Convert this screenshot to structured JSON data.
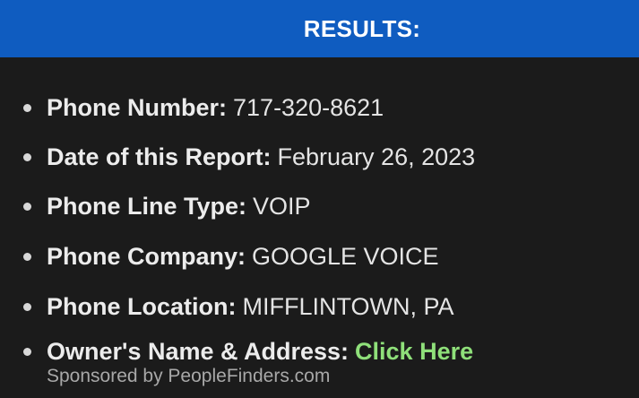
{
  "header": {
    "title": "RESULTS:"
  },
  "results": {
    "items": [
      {
        "label": "Phone Number:",
        "value": "717-320-8621"
      },
      {
        "label": "Date of this Report:",
        "value": "February 26, 2023"
      },
      {
        "label": "Phone Line Type:",
        "value": "VOIP"
      },
      {
        "label": "Phone Company:",
        "value": "GOOGLE VOICE"
      },
      {
        "label": "Phone Location:",
        "value": "MIFFLINTOWN, PA"
      },
      {
        "label": "Owner's Name & Address:",
        "link_text": "Click Here"
      }
    ],
    "sponsor_text": "Sponsored by PeopleFinders.com"
  },
  "colors": {
    "header_background": "#0f5cc0",
    "page_background": "#1b1b1b",
    "link": "#8fe07a"
  }
}
